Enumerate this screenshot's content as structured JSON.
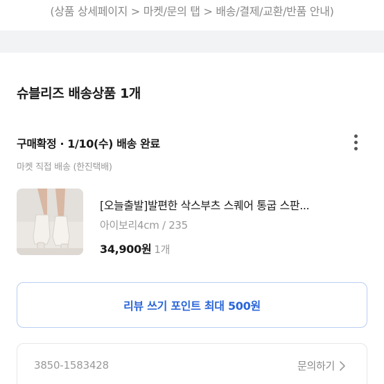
{
  "top_note": "(상품 상세페이지 > 마켓/문의 탭 > 배송/결제/교환/반품 안내)",
  "section": {
    "title": "슈블리즈 배송상품 1개"
  },
  "order": {
    "status": "구매확정 · 1/10(수) 배송 완료",
    "shipping_method": "마켓 직접 배송 (한진택배)",
    "more_icon": "more-vertical-icon"
  },
  "product": {
    "name": "[오늘출발]발편한 삭스부츠 스퀘어 통굽 스판...",
    "option": "아이보리4cm / 235",
    "price": "34,900원",
    "quantity": "1개",
    "thumbnail": "product-thumbnail-image"
  },
  "review_button": {
    "label": "리뷰 쓰기 포인트 최대 500원",
    "color": "#2b66d9"
  },
  "seller": {
    "phone": "3850-1583428",
    "inquiry_label": "문의하기",
    "inquiry_icon": "chevron-right-icon"
  }
}
